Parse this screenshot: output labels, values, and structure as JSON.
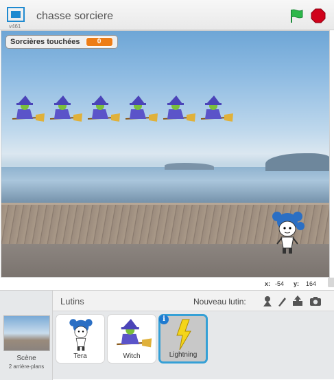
{
  "titlebar": {
    "version": "v461",
    "project_title": "chasse sorciere"
  },
  "stage": {
    "monitor": {
      "label": "Sorcières touchées",
      "value": "0"
    },
    "witch_count": 6
  },
  "coords": {
    "x_label": "x:",
    "x_value": "-54",
    "y_label": "y:",
    "y_value": "164"
  },
  "sprites_panel": {
    "title": "Lutins",
    "new_sprite_label": "Nouveau lutin:",
    "scene": {
      "label": "Scène",
      "backdrops": "2 arrière-plans"
    },
    "sprites": [
      {
        "name": "Tera"
      },
      {
        "name": "Witch"
      },
      {
        "name": "Lightning",
        "selected": true
      }
    ]
  },
  "colors": {
    "accent": "#35a0d6",
    "monitor_orange": "#ee7d16",
    "flag_green": "#2db84a",
    "stop_red": "#d0021b"
  }
}
